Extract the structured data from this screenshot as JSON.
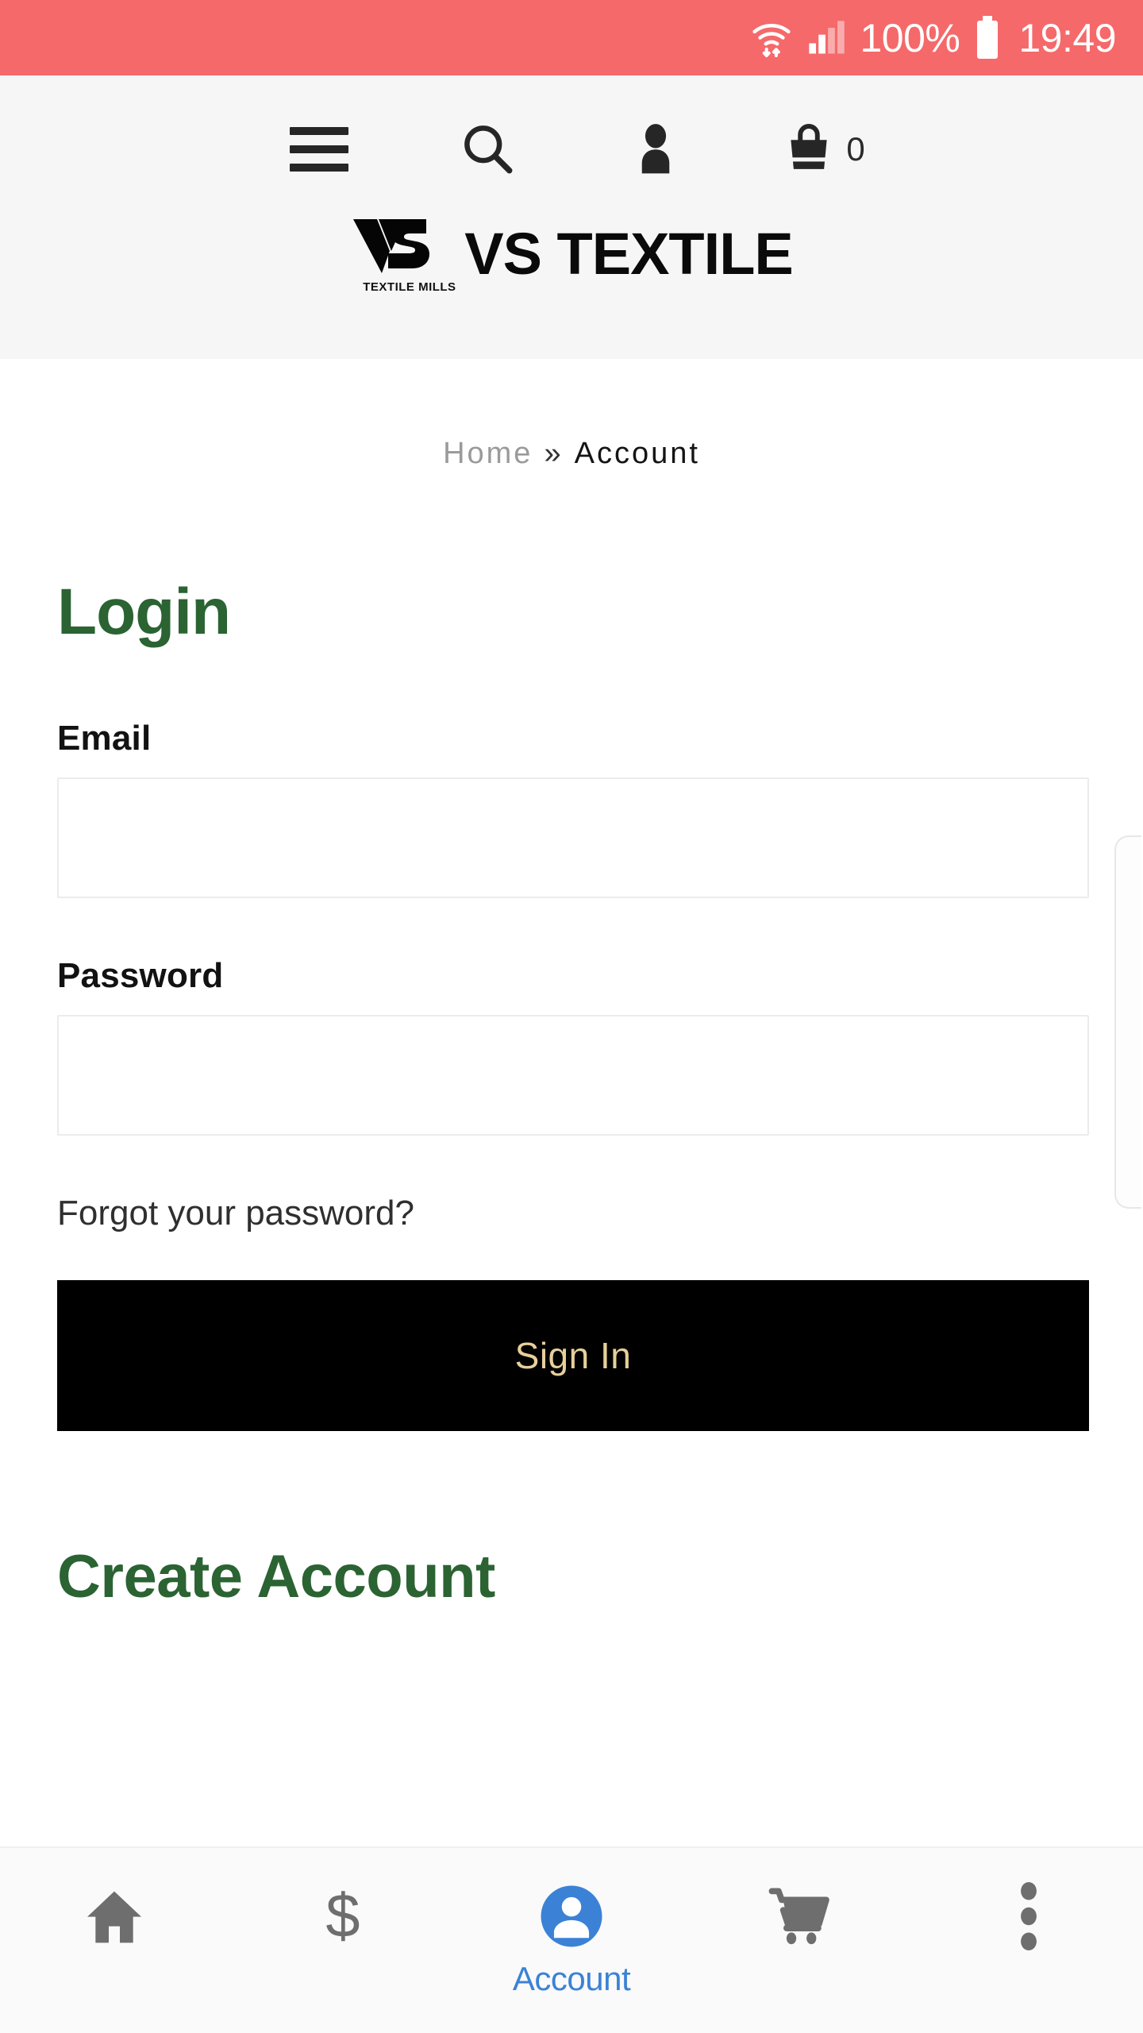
{
  "status_bar": {
    "wifi_icon": "wifi-icon",
    "signal_icon": "cellular-signal-icon",
    "battery_percent": "100%",
    "battery_icon": "battery-full-icon",
    "clock": "19:49",
    "background_color": "#f5696a",
    "text_color": "#ffffff"
  },
  "header": {
    "background_color": "#f6f6f6",
    "nav": {
      "menu_icon": "hamburger-menu-icon",
      "search_icon": "search-icon",
      "account_icon": "person-icon",
      "cart_icon": "shopping-bag-icon",
      "cart_count": "0"
    },
    "logo": {
      "mark_text": "VS",
      "mark_tagline": "TEXTILE MILLS",
      "wordmark": "VS TEXTILE"
    }
  },
  "breadcrumb": {
    "home": "Home",
    "separator": "»",
    "current": "Account"
  },
  "login": {
    "heading": "Login",
    "heading_color": "#2b6333",
    "email_label": "Email",
    "email_value": "",
    "email_placeholder": "",
    "password_label": "Password",
    "password_value": "",
    "password_placeholder": "",
    "forgot_link": "Forgot your password?",
    "submit_label": "Sign In",
    "submit_bg": "#000000",
    "submit_text_color": "#e6cf9a"
  },
  "create_account": {
    "heading": "Create Account",
    "heading_color": "#2b6333"
  },
  "bottom_nav": {
    "active_color": "#3b82d6",
    "inactive_color": "#6e6e6e",
    "items": [
      {
        "name": "home",
        "icon": "home-icon",
        "label": ""
      },
      {
        "name": "price",
        "icon": "dollar-sign-icon",
        "label": ""
      },
      {
        "name": "account",
        "icon": "account-person-icon",
        "label": "Account"
      },
      {
        "name": "cart",
        "icon": "shopping-cart-icon",
        "label": ""
      },
      {
        "name": "more",
        "icon": "more-vertical-icon",
        "label": ""
      }
    ]
  }
}
